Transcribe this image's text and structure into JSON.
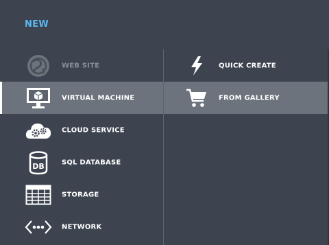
{
  "panel": {
    "title": "NEW"
  },
  "left_items": [
    {
      "label": "WEB SITE",
      "icon": "globe-icon",
      "state": "disabled"
    },
    {
      "label": "VIRTUAL MACHINE",
      "icon": "monitor-icon",
      "state": "selected"
    },
    {
      "label": "CLOUD SERVICE",
      "icon": "cloud-gears-icon",
      "state": "normal"
    },
    {
      "label": "SQL DATABASE",
      "icon": "database-icon",
      "state": "normal"
    },
    {
      "label": "STORAGE",
      "icon": "table-grid-icon",
      "state": "normal"
    },
    {
      "label": "NETWORK",
      "icon": "network-icon",
      "state": "normal"
    }
  ],
  "right_items": [
    {
      "label": "QUICK CREATE",
      "icon": "lightning-icon",
      "state": "normal"
    },
    {
      "label": "FROM GALLERY",
      "icon": "shopping-cart-icon",
      "state": "selected"
    }
  ],
  "icon_text": {
    "database": "DB"
  },
  "colors": {
    "background": "#3d4450",
    "selected_row": "#6c737c",
    "title_accent": "#5bb8f0",
    "disabled_text": "#8a9099"
  }
}
